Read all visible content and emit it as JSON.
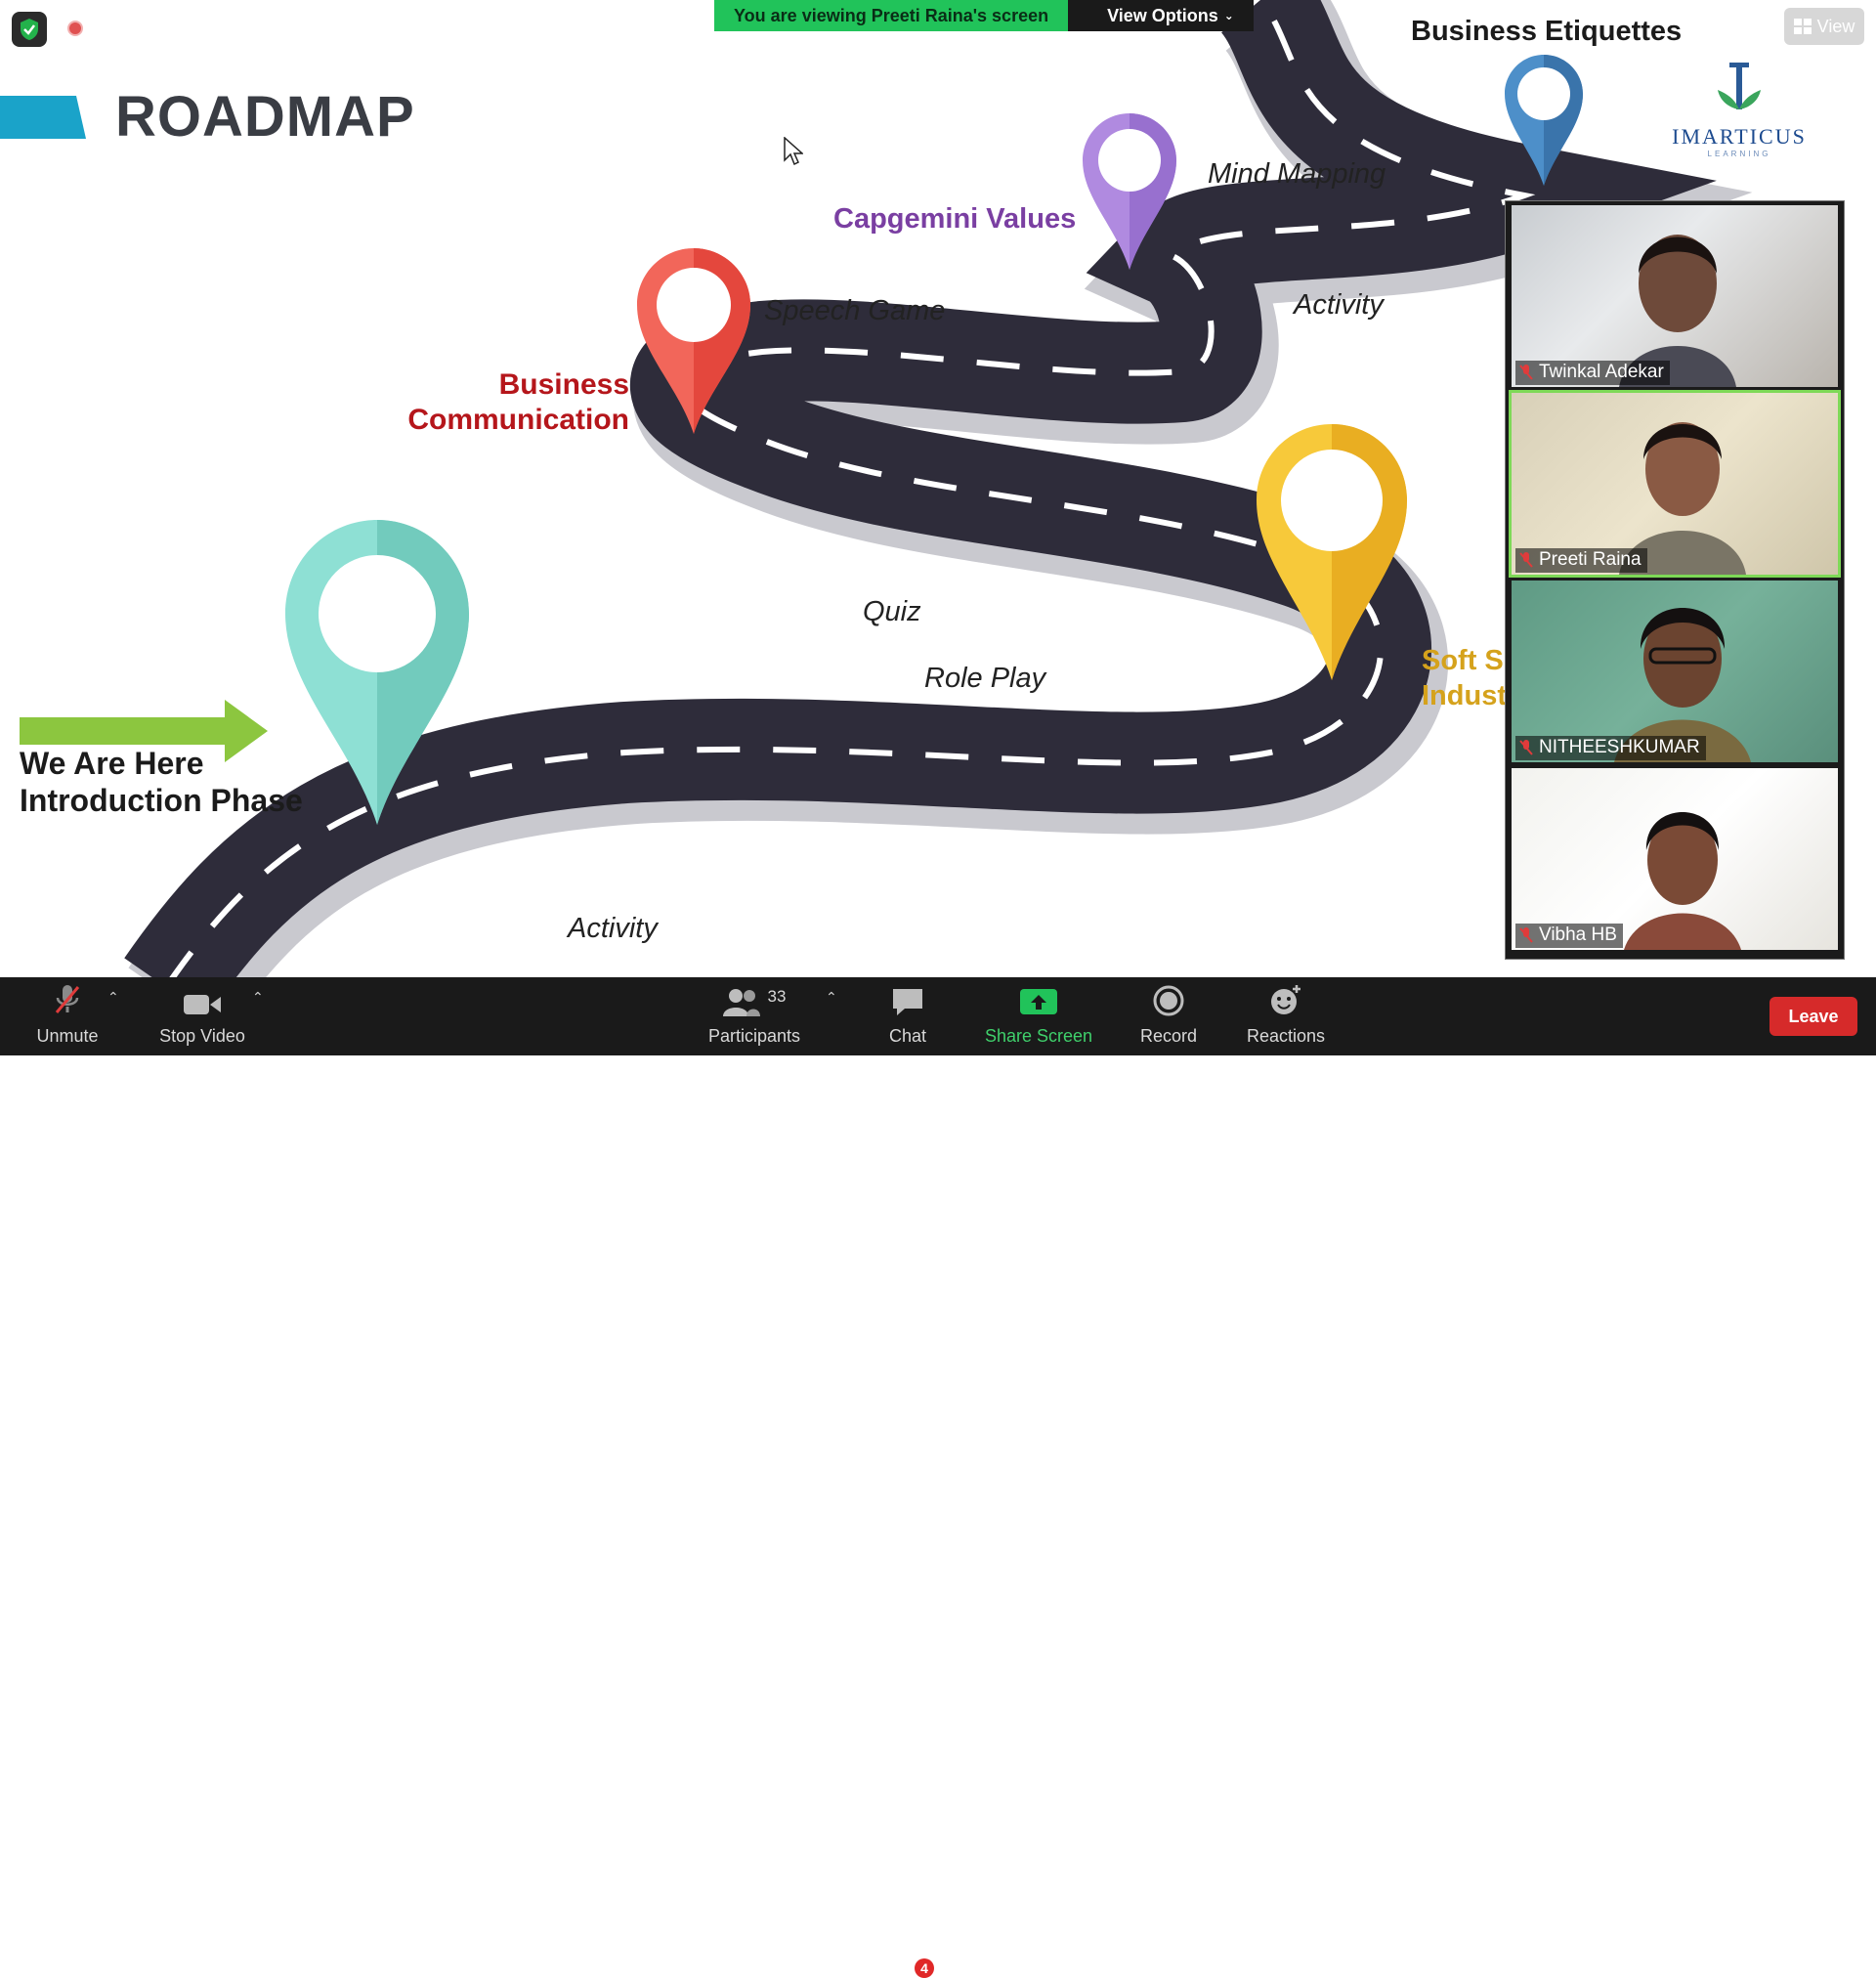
{
  "banner": {
    "viewing_text": "You are viewing Preeti Raina's screen",
    "view_options_label": "View Options"
  },
  "top_right": {
    "view_label": "View"
  },
  "slide": {
    "title": "ROADMAP",
    "logo_brand": "IMARTICUS",
    "logo_sub": "LEARNING",
    "stops": {
      "business_etiquettes": "Business Etiquettes",
      "capgemini_values": "Capgemini Values",
      "business_communication_1": "Business",
      "business_communication_2": "Communication",
      "soft_skills_1": "Soft S",
      "soft_skills_2": "Indust",
      "we_are_here_1": "We Are Here",
      "we_are_here_2": "Introduction Phase"
    },
    "activities": {
      "mind_mapping": "Mind Mapping",
      "activity_top": "Activity",
      "speech_game": "Speech Game",
      "quiz": "Quiz",
      "role_play": "Role Play",
      "activity_bottom": "Activity"
    }
  },
  "participants_gallery": [
    {
      "name": "Twinkal Adekar",
      "muted": true
    },
    {
      "name": "Preeti Raina",
      "muted": true,
      "active_speaker": true
    },
    {
      "name": "NITHEESHKUMAR",
      "muted": true
    },
    {
      "name": "Vibha HB",
      "muted": true
    }
  ],
  "toolbar": {
    "unmute": "Unmute",
    "stop_video": "Stop Video",
    "participants": "Participants",
    "participants_count": "33",
    "chat": "Chat",
    "chat_badge": "4",
    "share_screen": "Share Screen",
    "record": "Record",
    "reactions": "Reactions",
    "leave": "Leave"
  },
  "colors": {
    "share_green": "#21c35a",
    "leave_red": "#d62a2a",
    "road": "#2e2c3a"
  }
}
